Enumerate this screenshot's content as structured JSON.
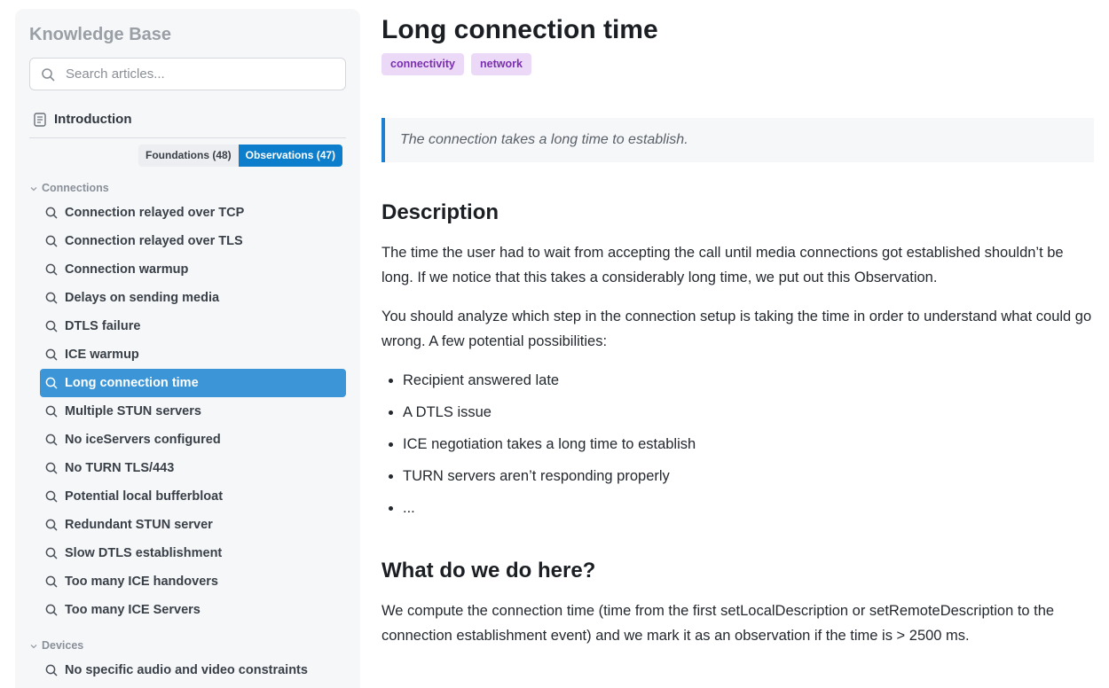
{
  "sidebar": {
    "title": "Knowledge Base",
    "search_placeholder": "Search articles...",
    "intro_label": "Introduction",
    "tabs": [
      {
        "label": "Foundations (48)",
        "active": false
      },
      {
        "label": "Observations (47)",
        "active": true
      }
    ],
    "groups": [
      {
        "label": "Connections",
        "items": [
          {
            "label": "Connection relayed over TCP",
            "active": false
          },
          {
            "label": "Connection relayed over TLS",
            "active": false
          },
          {
            "label": "Connection warmup",
            "active": false
          },
          {
            "label": "Delays on sending media",
            "active": false
          },
          {
            "label": "DTLS failure",
            "active": false
          },
          {
            "label": "ICE warmup",
            "active": false
          },
          {
            "label": "Long connection time",
            "active": true
          },
          {
            "label": "Multiple STUN servers",
            "active": false
          },
          {
            "label": "No iceServers configured",
            "active": false
          },
          {
            "label": "No TURN TLS/443",
            "active": false
          },
          {
            "label": "Potential local bufferbloat",
            "active": false
          },
          {
            "label": "Redundant STUN server",
            "active": false
          },
          {
            "label": "Slow DTLS establishment",
            "active": false
          },
          {
            "label": "Too many ICE handovers",
            "active": false
          },
          {
            "label": "Too many ICE Servers",
            "active": false
          }
        ]
      },
      {
        "label": "Devices",
        "items": [
          {
            "label": "No specific audio and video constraints",
            "active": false
          }
        ]
      }
    ]
  },
  "article": {
    "title": "Long connection time",
    "tags": [
      "connectivity",
      "network"
    ],
    "summary": "The connection takes a long time to establish.",
    "description_heading": "Description",
    "description_p1": "The time the user had to wait from accepting the call until media connections got established shouldn’t be long. If we notice that this takes a considerably long time, we put out this Observation.",
    "description_p2": "You should analyze which step in the connection setup is taking the time in order to understand what could go wrong. A few potential possibilities:",
    "possibilities": [
      "Recipient answered late",
      "A DTLS issue",
      "ICE negotiation takes a long time to establish",
      "TURN servers aren’t responding properly",
      "..."
    ],
    "action_heading": "What do we do here?",
    "action_p": "We compute the connection time (time from the first setLocalDescription or setRemoteDescription to the connection establishment event) and we mark it as an observation if the time is > 2500 ms."
  },
  "colors": {
    "accent": "#0d7ecb",
    "active_item": "#3b95d6",
    "tag_bg": "#ecd9f8",
    "tag_text": "#7a2fb0",
    "quote_border": "#1c7fd0"
  },
  "icons": {
    "search": "search-icon",
    "document": "document-icon",
    "chevron": "chevron-down-icon",
    "item": "magnifier-icon"
  }
}
